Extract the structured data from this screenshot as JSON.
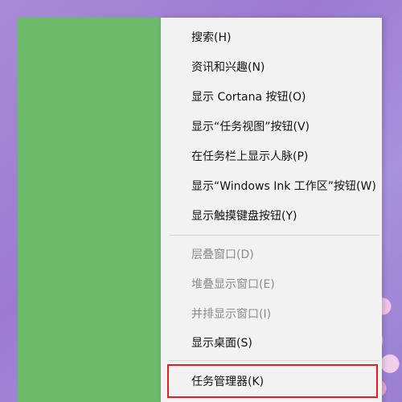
{
  "context_menu": {
    "items": [
      {
        "label": "搜索(H)",
        "disabled": false
      },
      {
        "label": "资讯和兴趣(N)",
        "disabled": false
      },
      {
        "label": "显示 Cortana 按钮(O)",
        "disabled": false
      },
      {
        "label": "显示“任务视图”按钮(V)",
        "disabled": false
      },
      {
        "label": "在任务栏上显示人脉(P)",
        "disabled": false
      },
      {
        "label": "显示“Windows Ink 工作区”按钮(W)",
        "disabled": false
      },
      {
        "label": "显示触摸键盘按钮(Y)",
        "disabled": false
      },
      {
        "label": "层叠窗口(D)",
        "disabled": true
      },
      {
        "label": "堆叠显示窗口(E)",
        "disabled": true
      },
      {
        "label": "并排显示窗口(I)",
        "disabled": true
      },
      {
        "label": "显示桌面(S)",
        "disabled": false
      },
      {
        "label": "任务管理器(K)",
        "disabled": false
      }
    ]
  },
  "colors": {
    "menu_background": "#f2f2f2",
    "disabled_text": "#8c8c8c",
    "highlight_border": "#e11f1f",
    "left_panel": "#6aba6a",
    "desktop": "#9a7fd0"
  }
}
